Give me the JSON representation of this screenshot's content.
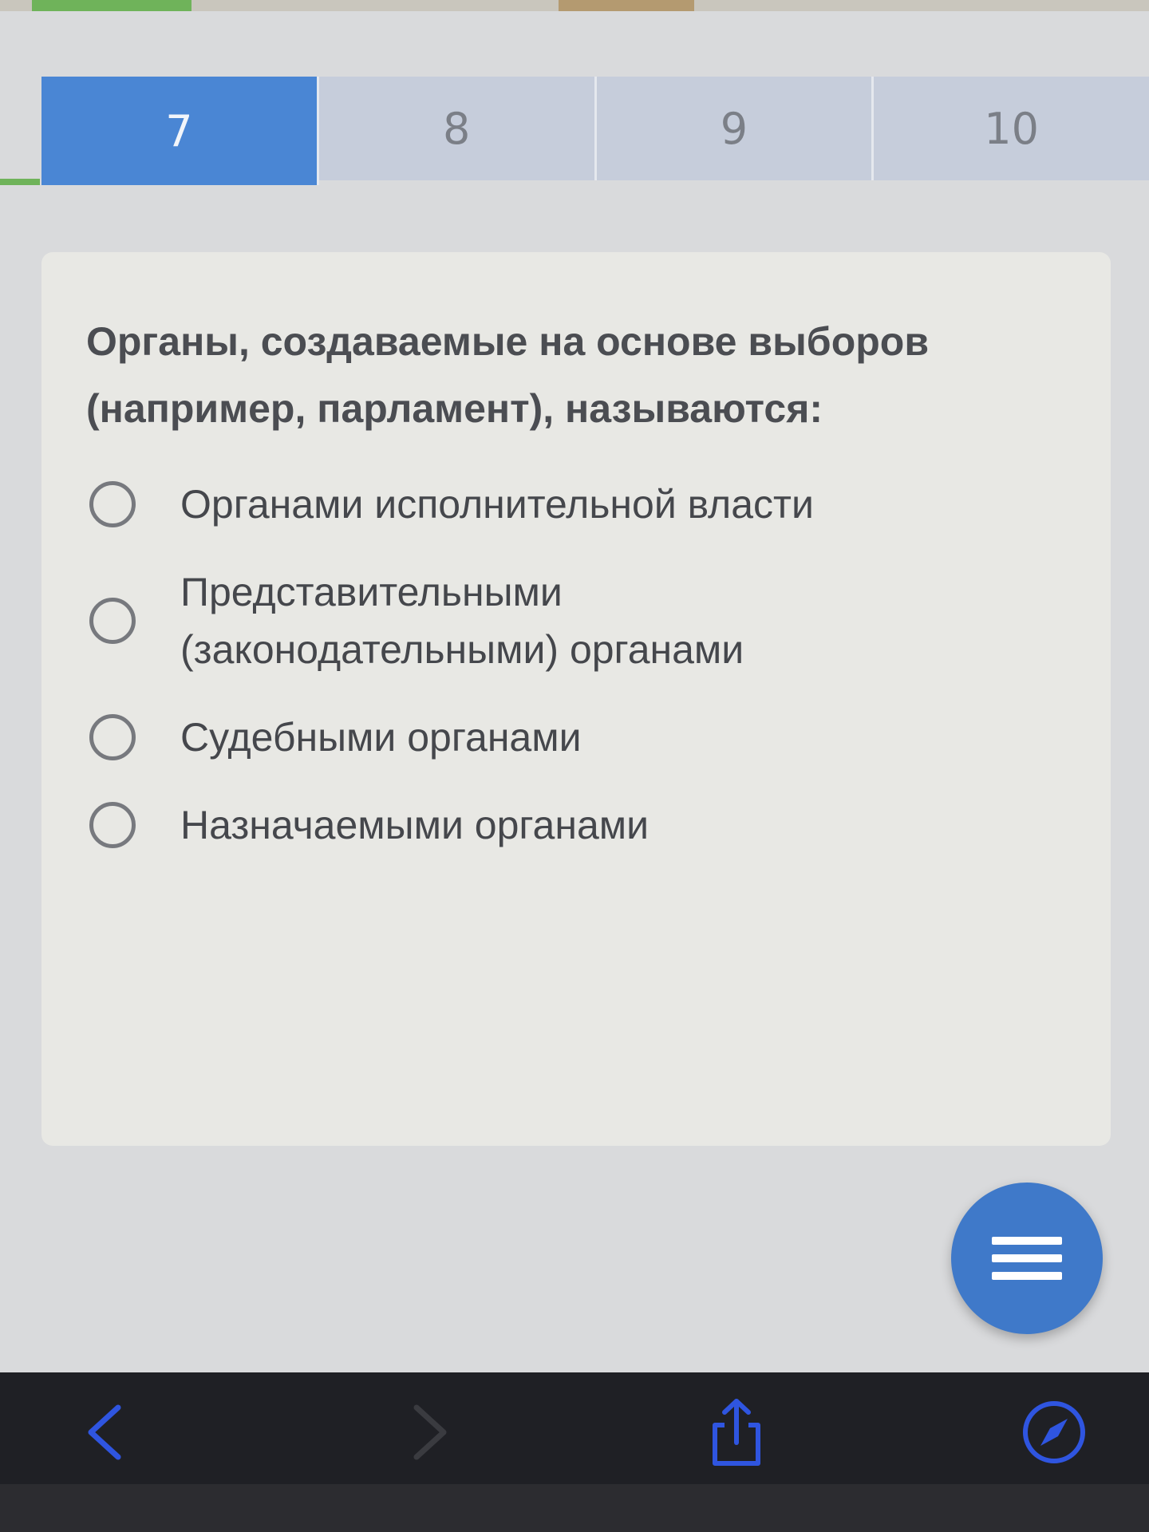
{
  "tabs": [
    {
      "label": "7",
      "active": true
    },
    {
      "label": "8",
      "active": false
    },
    {
      "label": "9",
      "active": false
    },
    {
      "label": "10",
      "active": false
    }
  ],
  "question": {
    "text": "Органы, создаваемые на основе выборов (например, парламент), называются:"
  },
  "options": [
    {
      "label": "Органами исполнительной власти"
    },
    {
      "label": "Представительными (законодательными) органами"
    },
    {
      "label": "Судебными органами"
    },
    {
      "label": "Назначаемыми органами"
    }
  ],
  "fab": {
    "icon": "hamburger-menu-icon"
  },
  "toolbar": {
    "icons": [
      "back-arrow-icon",
      "forward-arrow-icon",
      "share-icon",
      "compass-icon"
    ]
  },
  "colors": {
    "active_tab": "#4a86d4",
    "inactive_tab": "#c6cddb",
    "fab": "#3f79c9",
    "toolbar_icons": "#2f55e0"
  }
}
